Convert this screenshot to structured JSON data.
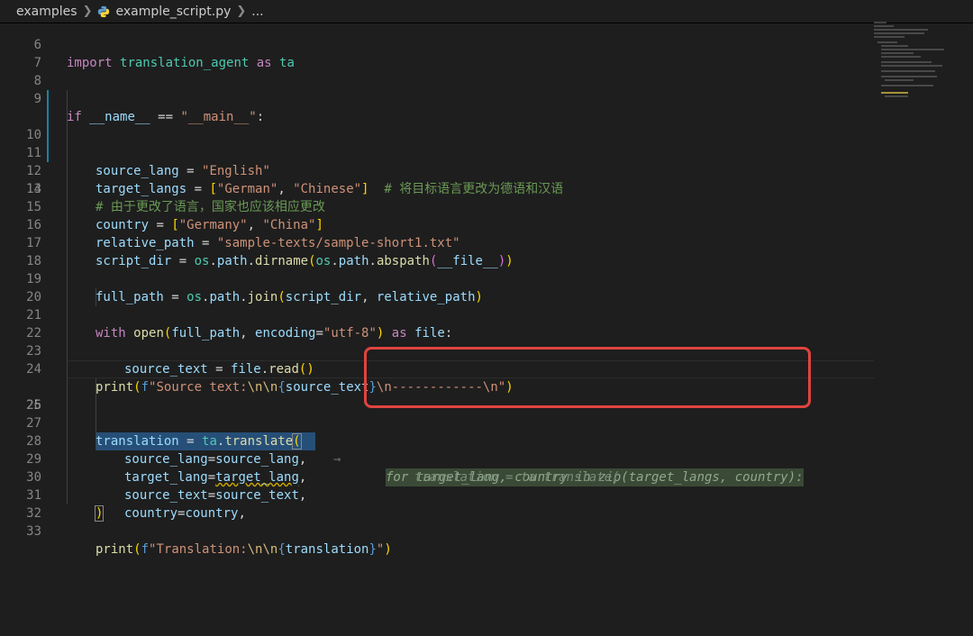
{
  "breadcrumb": {
    "folder": "examples",
    "file": "example_script.py",
    "ellipsis": "..."
  },
  "icons": {
    "file_icon": "python-file-icon",
    "chevron": "chevron-right-icon"
  },
  "colors": {
    "background": "#1e1e1e",
    "highlight_border": "#e0443e",
    "line_numbers": "#858585"
  },
  "editor": {
    "active_line": "25",
    "lines": [
      {
        "n": "6",
        "t": "import translation_agent as ta"
      },
      {
        "n": "7",
        "t": ""
      },
      {
        "n": "8",
        "t": ""
      },
      {
        "n": "9",
        "t": "if __name__ == \"__main__\":"
      },
      {
        "n": "10",
        "t": "    source_lang = \"English\""
      },
      {
        "n": "11",
        "t": "    target_langs = [\"German\", \"Chinese\"]  # 将目标语言更改为德语和汉语"
      },
      {
        "n": "12",
        "t": "    # 由于更改了语言，国家也应该相应更改"
      },
      {
        "n": "13",
        "t": "    country = [\"Germany\", \"China\"]"
      },
      {
        "n": "14",
        "t": ""
      },
      {
        "n": "15",
        "t": "    relative_path = \"sample-texts/sample-short1.txt\""
      },
      {
        "n": "16",
        "t": "    script_dir = os.path.dirname(os.path.abspath(__file__))"
      },
      {
        "n": "17",
        "t": ""
      },
      {
        "n": "18",
        "t": "    full_path = os.path.join(script_dir, relative_path)"
      },
      {
        "n": "19",
        "t": ""
      },
      {
        "n": "20",
        "t": "    with open(full_path, encoding=\"utf-8\") as file:"
      },
      {
        "n": "21",
        "t": "        source_text = file.read()"
      },
      {
        "n": "22",
        "t": ""
      },
      {
        "n": "23",
        "t": "    print(f\"Source text:\\n\\n{source_text}\\n------------\\n\")"
      },
      {
        "n": "24",
        "t": ""
      },
      {
        "n": "25",
        "t": "    translation = ta.translate("
      },
      {
        "n": "26",
        "t": "        source_lang=source_lang,"
      },
      {
        "n": "27",
        "t": "        target_lang=target_lang,"
      },
      {
        "n": "28",
        "t": "        source_text=source_text,"
      },
      {
        "n": "29",
        "t": "        country=country,"
      },
      {
        "n": "30",
        "t": "    )"
      },
      {
        "n": "31",
        "t": ""
      },
      {
        "n": "32",
        "t": "    print(f\"Translation:\\n\\n{translation}\")"
      },
      {
        "n": "33",
        "t": ""
      }
    ],
    "tokens": {
      "import": "import",
      "mod_name": "translation_agent",
      "as": "as",
      "alias": "ta",
      "if": "if",
      "dunder_name": "__name__",
      "eq": " == ",
      "main_str": "\"__main__\"",
      "colon": ":",
      "source_lang": "source_lang",
      "assign": " = ",
      "english": "\"English\"",
      "target_langs": "target_langs",
      "german": "\"German\"",
      "chinese": "\"Chinese\"",
      "comma_sp": ", ",
      "comment_11": "# 将目标语言更改为德语和汉语",
      "comment_12": "# 由于更改了语言，国家也应该相应更改",
      "country": "country",
      "germany": "\"Germany\"",
      "china": "\"China\"",
      "relative_path": "relative_path",
      "rel_str": "\"sample-texts/sample-short1.txt\"",
      "script_dir": "script_dir",
      "os": "os",
      "path": "path",
      "dirname": "dirname",
      "abspath": "abspath",
      "file_dunder": "__file__",
      "full_path": "full_path",
      "join": "join",
      "with": "with",
      "open": "open",
      "encoding": "encoding",
      "utf8": "\"utf-8\"",
      "file": "file",
      "source_text": "source_text",
      "read": "read",
      "print": "print",
      "f": "f",
      "src_str_a": "\"Source text:",
      "nn": "\\n\\n",
      "src_str_b": "\\n------------\\n\"",
      "translation": "translation",
      "ta": "ta",
      "translate": "translate",
      "target_lang": "target_lang",
      "tr_str_a": "\"Translation:",
      "quote": "\""
    },
    "suggestion": {
      "tab_hint": "→",
      "line1": "for target_lang, country in zip(target_langs, country):",
      "line2": "translation = ta.translate("
    }
  }
}
